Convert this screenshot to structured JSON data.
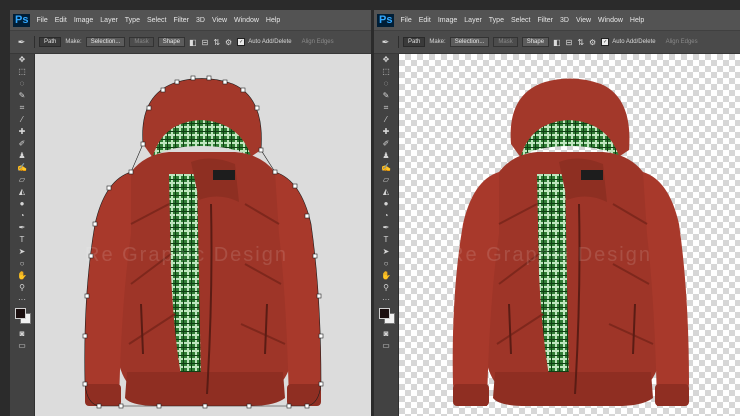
{
  "app": {
    "logo": "Ps",
    "menu": [
      "File",
      "Edit",
      "Image",
      "Layer",
      "Type",
      "Select",
      "Filter",
      "3D",
      "View",
      "Window",
      "Help"
    ]
  },
  "options_bar": {
    "tool_mode": "Path",
    "make_label": "Make:",
    "selection_button": "Selection...",
    "mask_button": "Mask",
    "shape_button": "Shape",
    "auto_add_delete_label": "Auto Add/Delete",
    "auto_add_delete_checked": true,
    "align_edges_label": "Align Edges"
  },
  "tools": [
    "move-icon",
    "marquee-icon",
    "lasso-icon",
    "quick-select-icon",
    "crop-icon",
    "eyedropper-icon",
    "healing-brush-icon",
    "brush-icon",
    "clone-stamp-icon",
    "history-brush-icon",
    "eraser-icon",
    "gradient-icon",
    "blur-icon",
    "dodge-icon",
    "pen-icon",
    "type-icon",
    "path-select-icon",
    "rectangle-icon",
    "hand-icon",
    "zoom-icon"
  ],
  "colors": {
    "foreground": "#1a0e0e",
    "background": "#f2f2f2",
    "jacket": "#a3382a",
    "plaid": "#3a8a3e"
  },
  "watermark": "Re Graphic Design"
}
